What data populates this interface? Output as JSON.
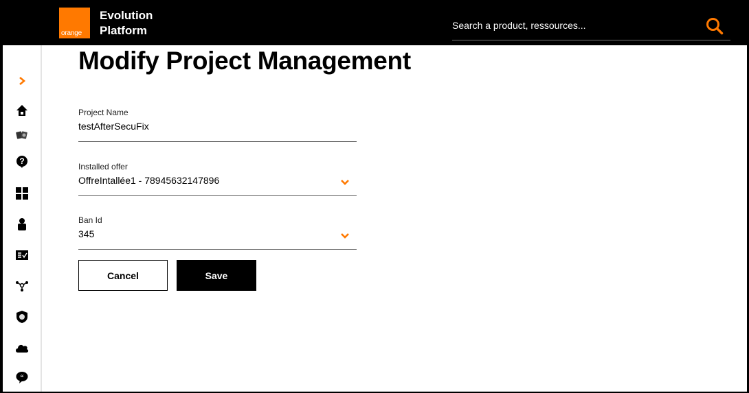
{
  "header": {
    "logo_text": "orange",
    "brand_line1": "Evolution",
    "brand_line2": "Platform",
    "search_placeholder": "Search a product, ressources...",
    "search_value": ""
  },
  "sidebar": {
    "items": [
      {
        "icon": "chevron-right-icon"
      },
      {
        "icon": "home-icon"
      },
      {
        "icon": "theater-icon"
      },
      {
        "icon": "help-icon"
      },
      {
        "icon": "dashboard-icon"
      },
      {
        "icon": "user-icon"
      },
      {
        "icon": "checklist-icon"
      },
      {
        "icon": "network-icon"
      },
      {
        "icon": "shield-icon"
      },
      {
        "icon": "cloud-icon"
      },
      {
        "icon": "quote-bubble-icon"
      }
    ]
  },
  "main": {
    "title": "Modify Project Management",
    "fields": [
      {
        "label": "Project Name",
        "value": "testAfterSecuFix",
        "type": "text"
      },
      {
        "label": "Installed offer",
        "value": "OffreIntallée1 - 78945632147896",
        "type": "select"
      },
      {
        "label": "Ban Id",
        "value": "345",
        "type": "select"
      }
    ],
    "cancel_label": "Cancel",
    "save_label": "Save"
  },
  "colors": {
    "accent": "#ff7900",
    "header_bg": "#000000"
  }
}
